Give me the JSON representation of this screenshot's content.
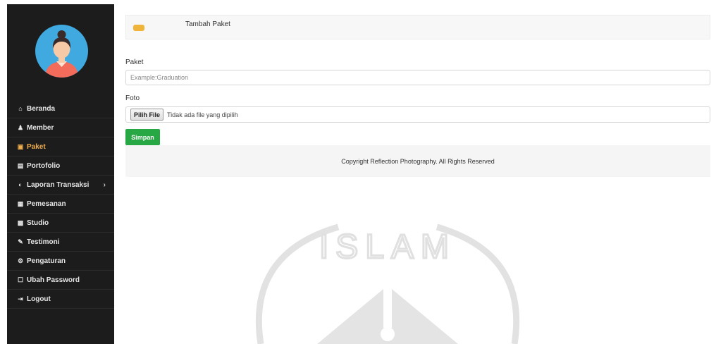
{
  "sidebar": {
    "items": [
      {
        "label": "Beranda",
        "icon": "home-icon",
        "glyph": "⌂"
      },
      {
        "label": "Member",
        "icon": "user-icon",
        "glyph": "♟"
      },
      {
        "label": "Paket",
        "icon": "image-icon",
        "glyph": "▣",
        "active": true
      },
      {
        "label": "Portofolio",
        "icon": "book-icon",
        "glyph": "▤"
      },
      {
        "label": "Laporan Transaksi",
        "icon": "globe-icon",
        "glyph": "◐",
        "chevron": "›"
      },
      {
        "label": "Pemesanan",
        "icon": "calendar-icon",
        "glyph": "▦"
      },
      {
        "label": "Studio",
        "icon": "picture-icon",
        "glyph": "▩"
      },
      {
        "label": "Testimoni",
        "icon": "pencil-icon",
        "glyph": "✎"
      },
      {
        "label": "Pengaturan",
        "icon": "gear-icon",
        "glyph": "⚙"
      },
      {
        "label": "Ubah Password",
        "icon": "edit-icon",
        "glyph": "☐"
      },
      {
        "label": "Logout",
        "icon": "logout-icon",
        "glyph": "⇥"
      }
    ]
  },
  "header": {
    "title": "Tambah Paket"
  },
  "form": {
    "paket_label": "Paket",
    "paket_placeholder": "Example:Graduation",
    "foto_label": "Foto",
    "file_button": "Pilih File",
    "file_status": "Tidak ada file yang dipilih",
    "submit_label": "Simpan"
  },
  "footer": {
    "text": "Copyright Reflection Photography. All Rights Reserved"
  },
  "watermark": {
    "text": "ISLAM"
  },
  "colors": {
    "sidebar_bg": "#1c1c1c",
    "active": "#f0ad4e",
    "save_button": "#28a745",
    "avatar_bg": "#3fa9e0"
  }
}
